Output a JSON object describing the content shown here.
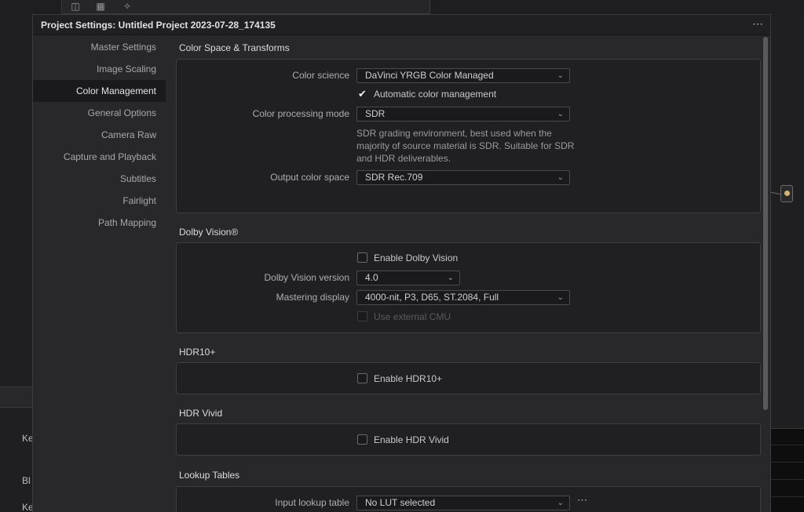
{
  "dialog": {
    "title": "Project Settings:  Untitled Project 2023-07-28_174135",
    "more_icon": "⋯"
  },
  "sidebar": {
    "items": [
      {
        "label": "Master Settings"
      },
      {
        "label": "Image Scaling"
      },
      {
        "label": "Color Management",
        "active": true
      },
      {
        "label": "General Options"
      },
      {
        "label": "Camera Raw"
      },
      {
        "label": "Capture and Playback"
      },
      {
        "label": "Subtitles"
      },
      {
        "label": "Fairlight"
      },
      {
        "label": "Path Mapping"
      }
    ]
  },
  "color_space": {
    "title": "Color Space & Transforms",
    "color_science_label": "Color science",
    "color_science_value": "DaVinci YRGB Color Managed",
    "auto_cm_label": "Automatic color management",
    "auto_cm_checked": true,
    "processing_mode_label": "Color processing mode",
    "processing_mode_value": "SDR",
    "processing_desc": "SDR grading environment, best used when the majority of source material is SDR. Suitable for SDR and HDR deliverables.",
    "output_label": "Output color space",
    "output_value": "SDR Rec.709"
  },
  "dolby": {
    "title": "Dolby Vision®",
    "enable_label": "Enable Dolby Vision",
    "version_label": "Dolby Vision version",
    "version_value": "4.0",
    "mastering_label": "Mastering display",
    "mastering_value": "4000-nit, P3, D65, ST.2084, Full",
    "external_cmu_label": "Use external CMU"
  },
  "hdr10": {
    "title": "HDR10+",
    "enable_label": "Enable HDR10+"
  },
  "hdr_vivid": {
    "title": "HDR Vivid",
    "enable_label": "Enable HDR Vivid"
  },
  "lut": {
    "title": "Lookup Tables",
    "input_label": "Input lookup table",
    "input_value": "No LUT selected"
  },
  "background": {
    "left_text_1": "Ke",
    "left_text_2": "Bl",
    "left_text_3": "Ke"
  }
}
